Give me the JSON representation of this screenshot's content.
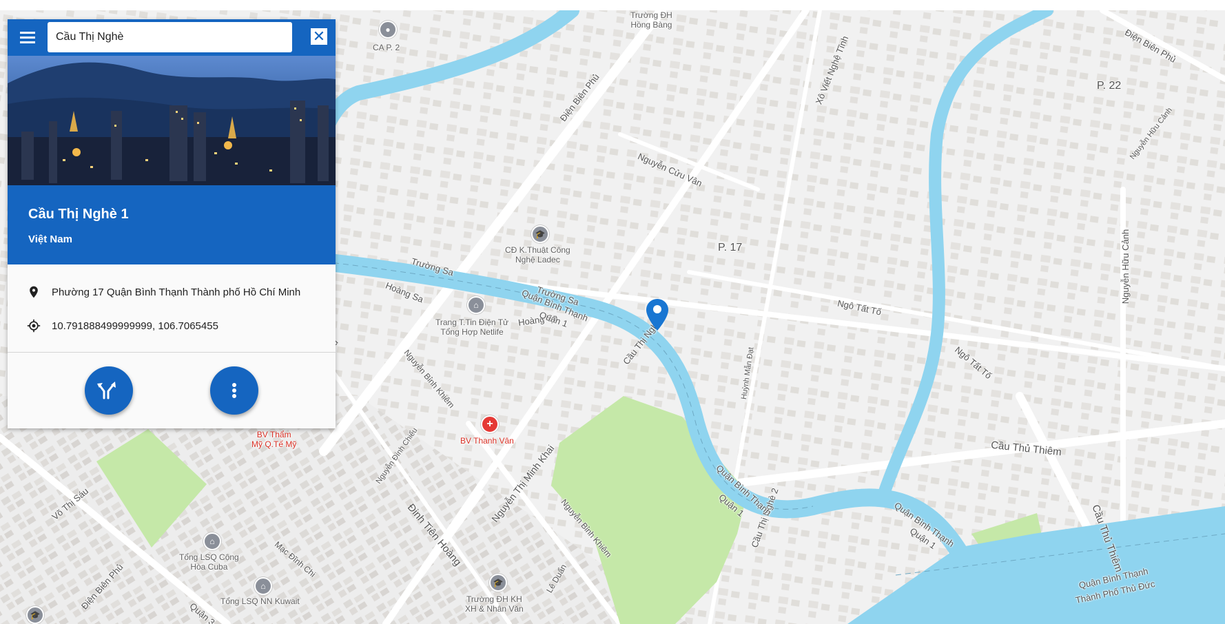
{
  "search": {
    "value": "Cầu Thị Nghè",
    "clear_symbol": "✕"
  },
  "place": {
    "title": "Cầu Thị Nghè 1",
    "country": "Việt Nam",
    "address": "Phường 17 Quận Bình Thạnh  Thành phố Hồ Chí Minh",
    "coordinates": "10.791888499999999, 106.7065455"
  },
  "actions": {
    "directions_icon": "directions-icon",
    "more_icon": "more-vert-icon"
  },
  "map_labels": {
    "dien_bien_phu_top": "Điện Biên Phủ",
    "dien_bien_phu_right": "Điện Biên Phủ",
    "dien_bien_phu_bottom": "Điện Biên Phủ",
    "dien_bien_phu_panel_edge": "ủ Phủ",
    "xo_viet_nghe_tinh": "Xô Viết Nghệ Tĩnh",
    "nguyen_cuu_van": "Nguyễn Cửu Vân",
    "p17": "P. 17",
    "p22": "P. 22",
    "truong_sa_1": "Trường Sa",
    "truong_sa_2": "Trường Sa",
    "hoang_sa_1": "Hoàng Sa",
    "hoang_sa_2": "Hoàng Sa",
    "quan_binh_thanh_1": "Quận Bình Thạnh",
    "quan_1_a": "Quận 1",
    "cau_thi_nghe_1": "Cầu Thị Nghè 1",
    "cau_thi_nghe_2": "Cầu Thị Nghè 2",
    "ngo_tat_to_1": "Ngô Tất Tố",
    "ngo_tat_to_2": "Ngô Tất Tố",
    "nguyen_huu_canh_1": "Nguyễn Hữu Cảnh",
    "nguyen_huu_canh_2": "Nguyễn Hữu Cảnh",
    "huynh_man_dat": "Huỳnh Mẫn Đạt",
    "cau_thu_thiem_1": "Cầu Thủ Thiêm",
    "cau_thu_thiem_2": "Cầu Thủ Thiêm",
    "nguyen_binh_khiem_1": "Nguyễn Bỉnh Khiêm",
    "nguyen_binh_khiem_2": "Nguyễn Bỉnh Khiêm",
    "nguyen_dinh_chieu": "Nguyễn Đình Chiểu",
    "nguyen_thi_minh_khai": "Nguyễn Thị Minh Khai",
    "dinh_tien_hoang": "Đinh Tiên Hoàng",
    "vo_thi_sau": "Võ Thị Sáu",
    "mac_dinh_chi": "Mạc Đĩnh Chi",
    "le_duan": "Lê Duẩn",
    "quan_3": "Quận 3",
    "qbt_river_1": "Quận Bình Thạnh",
    "q1_river_1": "Quận 1",
    "qbt_river_2": "Quận Bình Thạnh",
    "q1_river_2": "Quận 1",
    "qbt_thu_duc_1": "Quận Bình Thạnh",
    "qbt_thu_duc_2": "Thành Phố Thủ Đức"
  },
  "pois": {
    "truong_dh_hong_bang": "Trường ĐH\nHồng Bàng",
    "ca_p2": "CA P. 2",
    "cd_ky_thuat": "CĐ K.Thuật Công\nNghệ Ladec",
    "trang_tin": "Trang T.Tin Điện Tử\nTổng Hợp Netlife",
    "bv_thanh_van": "BV Thanh Vân",
    "bv_tham_my": "BV Thẩm\nMỹ Q.Tế Mỹ",
    "tong_lsq_cuba": "Tổng LSQ Cộng\nHòa Cuba",
    "tong_lsq_kuwait": "Tổng LSQ NN Kuwait",
    "truong_dh_kh": "Trường ĐH KH\nXH & Nhân Văn"
  },
  "colors": {
    "primary": "#1565c0",
    "water": "#8fd4ef",
    "park": "#c5e8a8",
    "poi_red": "#e53935",
    "map_bg": "#f2f2f2"
  }
}
